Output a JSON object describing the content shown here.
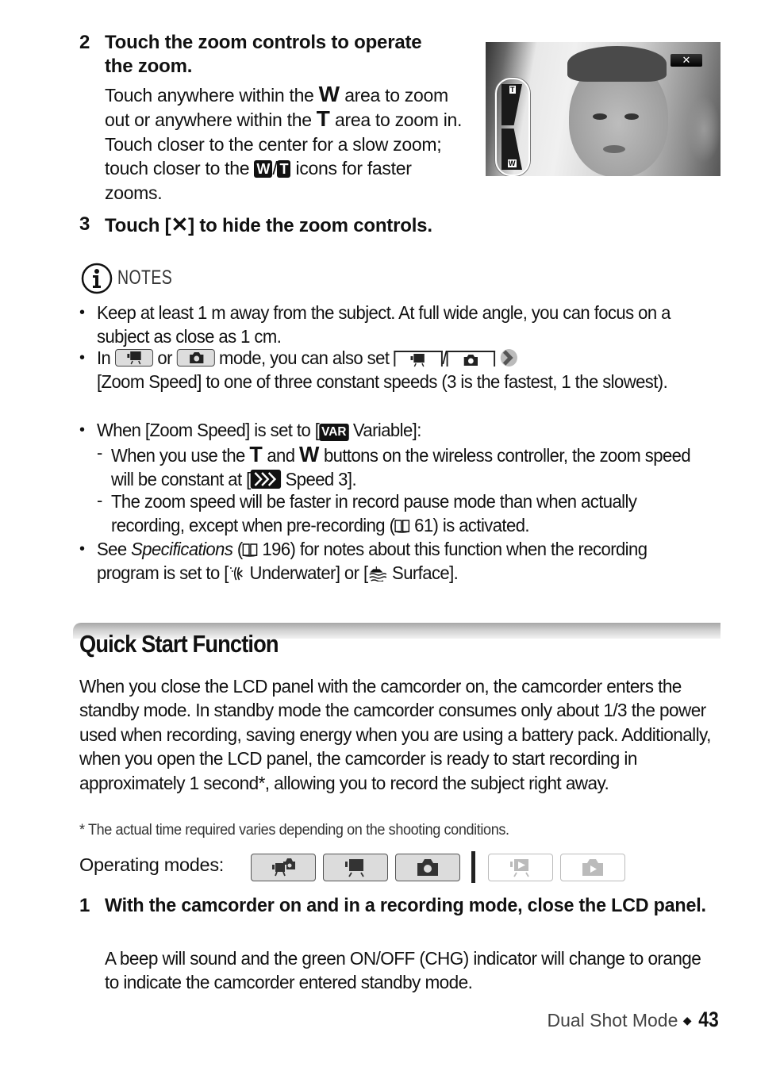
{
  "steps_top": [
    {
      "number": "2",
      "title": "Touch the zoom controls to operate the zoom.",
      "body": {
        "p1": "Touch anywhere within the",
        "w_glyph": "W",
        "p2": "area to zoom out or anywhere within the",
        "t_glyph": "T",
        "p3": "area to zoom in. Touch closer to the center  for a slow zoom; touch closer to the",
        "w_box": "W",
        "slash": "/",
        "t_box": "T",
        "p4": "icons for faster zooms."
      }
    },
    {
      "number": "3",
      "title_prefix": "Touch [",
      "title_glyph": "✕",
      "title_suffix": "] to hide the zoom controls."
    }
  ],
  "screenshot": {
    "close_label": "✕",
    "zoom_top_label": "T",
    "zoom_bottom_label": "W"
  },
  "notes": {
    "heading": "NOTES",
    "items": [
      {
        "text": "Keep at least 1 m away from the subject. At full wide angle, you can focus on a subject as close as 1 cm."
      },
      {
        "p1": "In",
        "p2": "or",
        "p3": "mode, you can also set",
        "slash": "/",
        "p4": "[Zoom Speed] to one of three constant speeds (3 is the fastest, 1 the slowest)."
      },
      {
        "p1": "When [Zoom Speed] is set to [",
        "var_label": "VAR",
        "p2": " Variable]:"
      },
      {
        "sub": true,
        "p1": "When you use the",
        "t_glyph": "T",
        "p2": "and",
        "w_glyph": "W",
        "p3": "buttons on the wireless controller, the zoom speed will be constant at [",
        "p4": " Speed 3]."
      },
      {
        "sub": true,
        "p1": "The zoom speed will be faster in record pause mode than when actually recording, except when pre-recording (",
        "ref": "61",
        "p2": ") is activated."
      },
      {
        "p1": "See ",
        "italic": "Specifications",
        "p2": " (",
        "ref": "196",
        "p3": ") for notes about this function when the recording program is set to [",
        "p4": " Underwater] or [",
        "p5": " Surface]."
      }
    ]
  },
  "section": {
    "title": "Quick Start Function",
    "paragraph": "When you close the LCD panel with the camcorder on, the camcorder enters the standby mode. In standby mode the camcorder consumes only about 1/3 the power used when recording, saving energy when you are using a battery pack. Additionally, when you open the LCD panel, the camcorder is ready to start recording in approximately 1 second*, allowing you to record the subject right away.",
    "footnote": "*  The actual time required varies depending on the shooting conditions.",
    "operating_modes_label": "Operating modes:",
    "operating_modes": [
      {
        "icon": "dual-shot-mode-icon",
        "enabled": true
      },
      {
        "icon": "movie-mode-icon",
        "enabled": true
      },
      {
        "icon": "photo-mode-icon",
        "enabled": true
      },
      {
        "icon": "movie-playback-icon",
        "enabled": false
      },
      {
        "icon": "photo-playback-icon",
        "enabled": false
      }
    ],
    "step": {
      "number": "1",
      "title": "With the camcorder on and in a recording mode, close the LCD panel.",
      "body": "A beep will sound and the green ON/OFF (CHG) indicator will change to orange to indicate the camcorder entered standby mode."
    }
  },
  "footer": {
    "chapter": "Dual Shot Mode",
    "separator": "◆",
    "page_number": "43"
  }
}
